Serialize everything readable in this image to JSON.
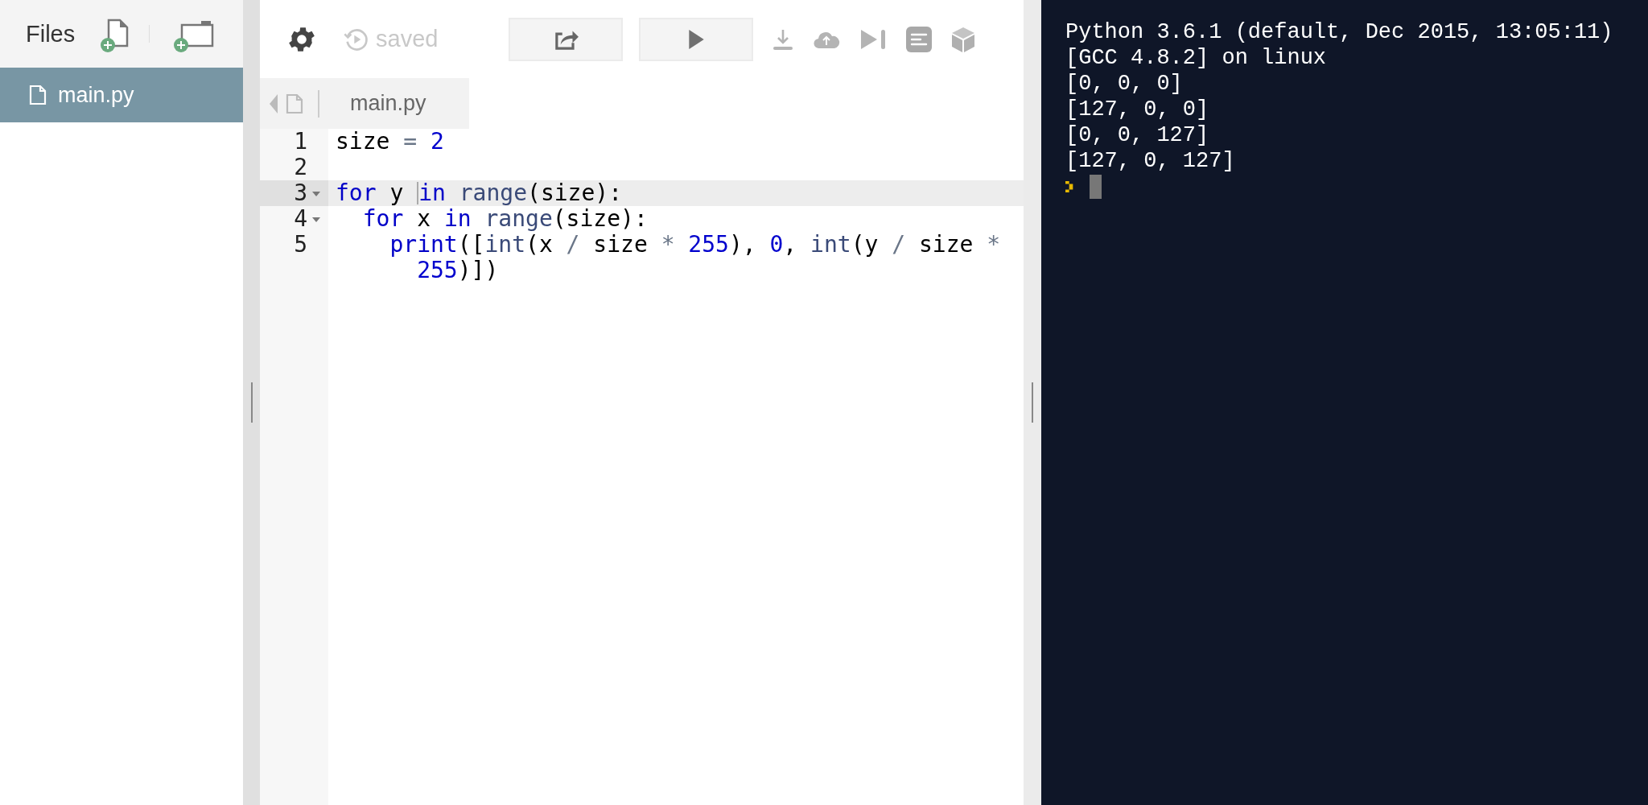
{
  "sidebar": {
    "title": "Files",
    "files": [
      {
        "name": "main.py",
        "selected": true
      }
    ]
  },
  "toolbar": {
    "status": "saved"
  },
  "editor": {
    "tabs": [
      {
        "label": "main.py",
        "selected": true
      }
    ],
    "lines": [
      {
        "number": "1",
        "foldable": false,
        "active": false,
        "tokens": [
          {
            "kind": "plain",
            "text": "size "
          },
          {
            "kind": "operator",
            "text": "= "
          },
          {
            "kind": "number",
            "text": "2"
          }
        ]
      },
      {
        "number": "2",
        "foldable": false,
        "active": false
      },
      {
        "number": "3",
        "foldable": true,
        "active": true,
        "tokens": [
          {
            "kind": "keyword",
            "text": "for "
          },
          {
            "kind": "plain",
            "text": "y "
          },
          {
            "kind": "cursor"
          },
          {
            "kind": "keyword",
            "text": "in "
          },
          {
            "kind": "builtin",
            "text": "range"
          },
          {
            "kind": "plain",
            "text": "(size):"
          }
        ]
      },
      {
        "number": "4",
        "foldable": true,
        "active": false,
        "tokens": [
          {
            "kind": "keyword",
            "text": "  for "
          },
          {
            "kind": "plain",
            "text": "x "
          },
          {
            "kind": "keyword",
            "text": "in "
          },
          {
            "kind": "builtin",
            "text": "range"
          },
          {
            "kind": "plain",
            "text": "(size):"
          }
        ]
      },
      {
        "number": "5",
        "foldable": false,
        "active": false,
        "tokens": [
          {
            "kind": "keyword",
            "text": "    print"
          },
          {
            "kind": "plain",
            "text": "(["
          },
          {
            "kind": "builtin",
            "text": "int"
          },
          {
            "kind": "plain",
            "text": "(x "
          },
          {
            "kind": "operator",
            "text": "/ "
          },
          {
            "kind": "plain",
            "text": "size "
          },
          {
            "kind": "operator",
            "text": "* "
          },
          {
            "kind": "number",
            "text": "255"
          },
          {
            "kind": "plain",
            "text": "), "
          },
          {
            "kind": "number",
            "text": "0"
          },
          {
            "kind": "plain",
            "text": ", "
          },
          {
            "kind": "builtin",
            "text": "int"
          },
          {
            "kind": "plain",
            "text": "(y "
          },
          {
            "kind": "operator",
            "text": "/ "
          },
          {
            "kind": "plain",
            "text": "size "
          },
          {
            "kind": "operator",
            "text": "* "
          },
          {
            "kind": "number",
            "text": "255"
          },
          {
            "kind": "plain",
            "text": ")])"
          }
        ]
      }
    ]
  },
  "terminal": {
    "lines": [
      "Python 3.6.1 (default, Dec 2015, 13:05:11)",
      "[GCC 4.8.2] on linux",
      "[0, 0, 0]",
      "[127, 0, 0]",
      "[0, 0, 127]",
      "[127, 0, 127]"
    ]
  }
}
